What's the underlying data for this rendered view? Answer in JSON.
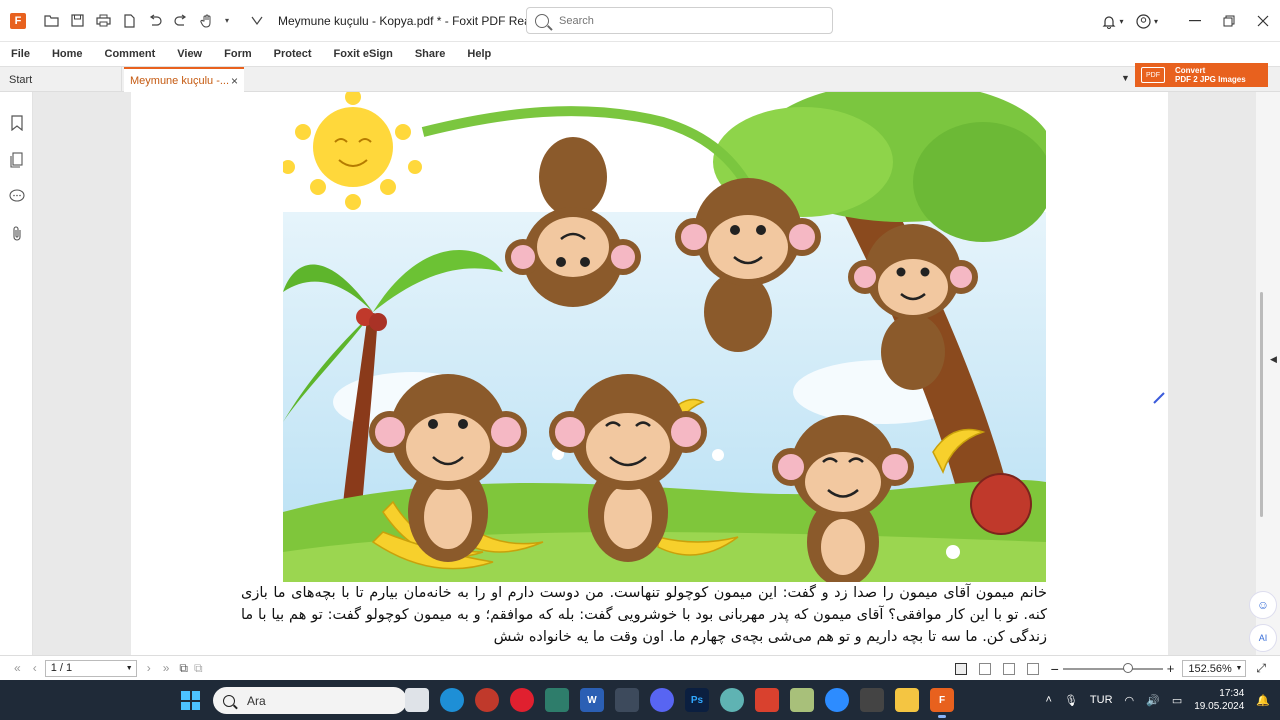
{
  "app": {
    "logo_glyph": "F",
    "document_title": "Meymune kuçulu - Kopya.pdf * - Foxit PDF Reader",
    "search_placeholder": "Search"
  },
  "menu": [
    "File",
    "Home",
    "Comment",
    "View",
    "Form",
    "Protect",
    "Foxit eSign",
    "Share",
    "Help"
  ],
  "tabs": {
    "start_label": "Start",
    "doc_label": "Meymune kuçulu -...",
    "close_glyph": "×"
  },
  "convert_ad": {
    "icon_text": "PDF",
    "line1": "Convert",
    "line2": "PDF 2 JPG Images"
  },
  "page": {
    "caption": "خانم میمون آقای میمون را صدا زد و گفت: این میمون کوچولو تنهاست. من دوست دارم او را به خانه‌مان بیارم تا با بچه‌های ما بازی کنه. تو با این کار موافقی؟ آقای میمون که پدر مهربانی بود با خوشرویی گفت: بله که موافقم؛ و به میمون کوچولو گفت: تو هم بیا با ما زندگی کن. ما سه تا بچه داریم و تو هم می‌شی بچه‌ی چهارم ما. اون وقت ما یه خانواده شش"
  },
  "status": {
    "page_indicator": "1 / 1",
    "zoom": "152.56%"
  },
  "taskbar": {
    "search_text": "Ara",
    "language": "TUR",
    "time": "17:34",
    "date": "19.05.2024"
  },
  "colors": {
    "accent": "#e8611e",
    "taskbar": "#1f2a38"
  }
}
